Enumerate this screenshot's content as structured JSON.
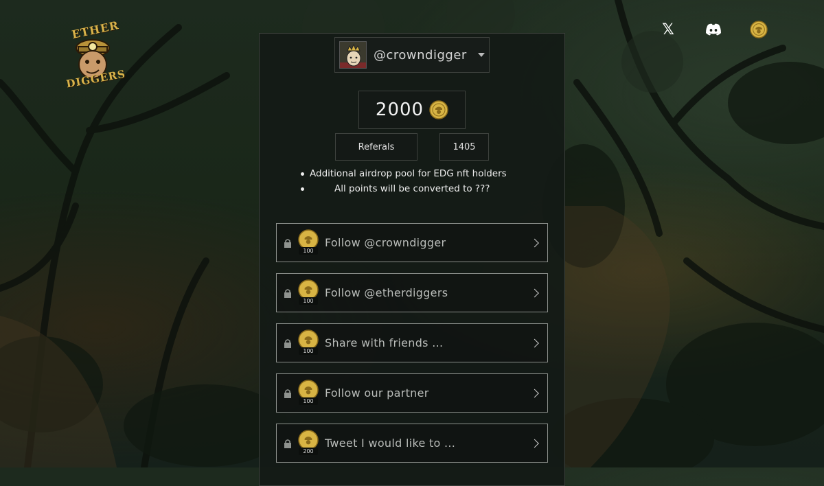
{
  "brand": {
    "logo_line1": "ETHER",
    "logo_line2": "DIGGERS"
  },
  "nav": {
    "icons": [
      "x-icon",
      "discord-icon",
      "coin-icon"
    ],
    "x_glyph": "𝕏"
  },
  "profile": {
    "username": "@crowndigger"
  },
  "points": {
    "total": "2000"
  },
  "referrals": {
    "label": "Referals",
    "count": "1405"
  },
  "notes": [
    "Additional airdrop pool for EDG nft holders",
    "All points will be converted to ???"
  ],
  "tasks": [
    {
      "label": "Follow @crowndigger",
      "points": "100",
      "locked": true
    },
    {
      "label": "Follow @etherdiggers",
      "points": "100",
      "locked": true
    },
    {
      "label": "Share with friends ...",
      "points": "100",
      "locked": true
    },
    {
      "label": "Follow our partner",
      "points": "100",
      "locked": true
    },
    {
      "label": "Tweet I would like to ...",
      "points": "200",
      "locked": true
    }
  ],
  "colors": {
    "coin": "#d8b444",
    "panel_bg": "#141a16",
    "border": "#3e423e"
  }
}
